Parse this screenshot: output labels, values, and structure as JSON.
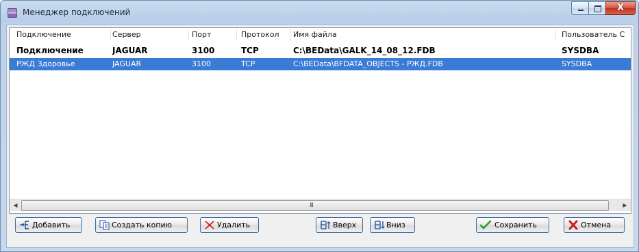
{
  "window": {
    "title": "Менеджер подключений",
    "close_glyph": "X"
  },
  "grid": {
    "columns": [
      "Подключение",
      "Сервер",
      "Порт",
      "Протокол",
      "Имя файла",
      "Пользователь С"
    ],
    "rows": [
      {
        "connection": "Подключение",
        "server": "JAGUAR",
        "port": "3100",
        "protocol": "TCP",
        "file": "C:\\BEData\\GALK_14_08_12.FDB",
        "user": "SYSDBA",
        "style": "bold"
      },
      {
        "connection": "РЖД Здоровье",
        "server": "JAGUAR",
        "port": "3100",
        "protocol": "TCP",
        "file": "C:\\BEData\\BFDATA_OBJECTS - РЖД.FDB",
        "user": "SYSDBA",
        "style": "selected"
      }
    ],
    "scroll_grip": "III"
  },
  "buttons": {
    "add": "Добавить",
    "copy": "Создать копию",
    "delete": "Удалить",
    "up": "Вверх",
    "down": "Вниз",
    "save": "Сохранить",
    "cancel": "Отмена"
  },
  "icons": {
    "app": "connection-manager-icon",
    "add": "add-row-icon",
    "copy": "copy-icon",
    "delete": "red-x-icon",
    "up": "move-up-icon",
    "down": "move-down-icon",
    "save": "green-check-icon",
    "cancel": "red-x-icon"
  },
  "colors": {
    "selection": "#3a7bd5",
    "title_close": "#c2311b",
    "button_border": "#3a6ea5",
    "check_green": "#2f9a2a",
    "x_red": "#cc1f1f"
  }
}
